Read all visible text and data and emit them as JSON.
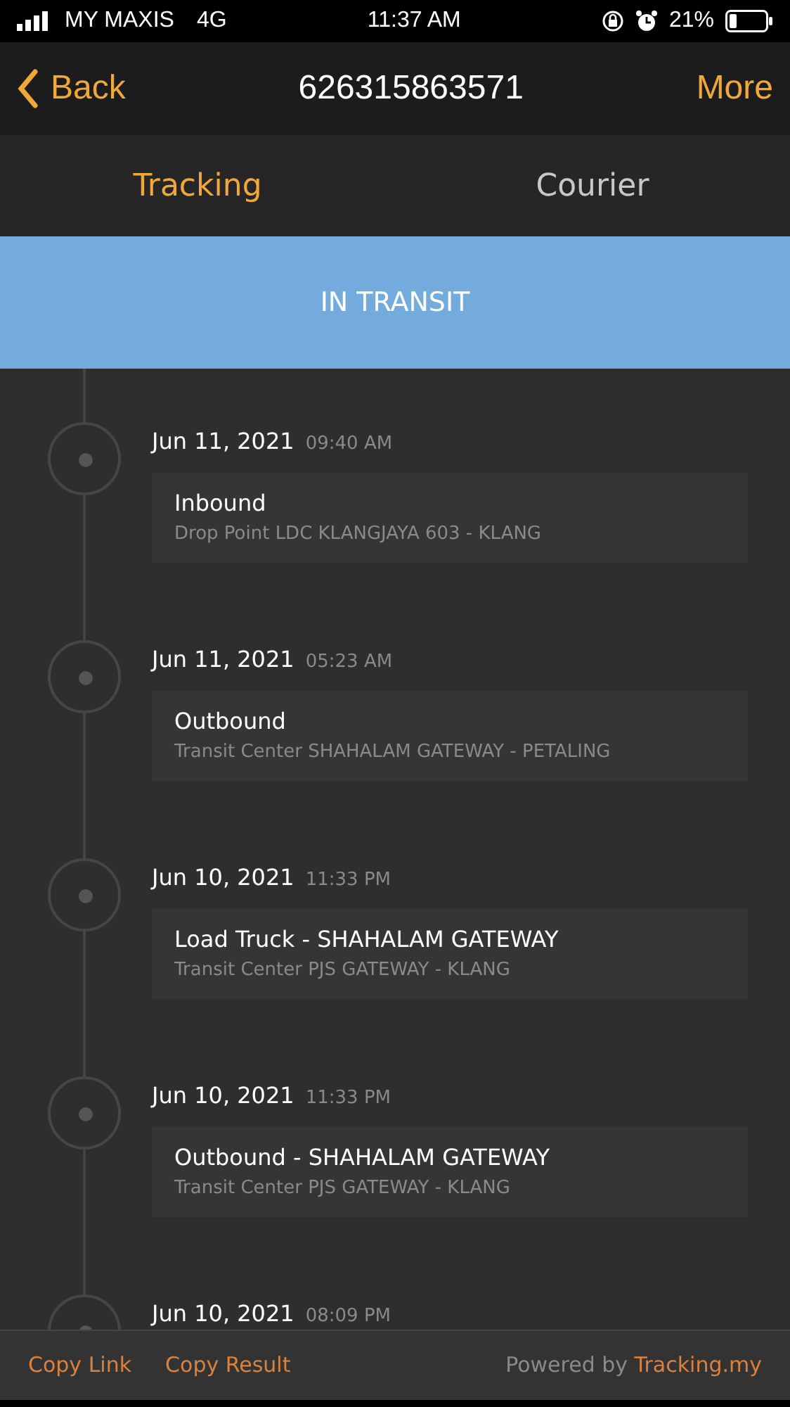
{
  "status_bar": {
    "carrier": "MY MAXIS",
    "network": "4G",
    "time": "11:37 AM",
    "battery": "21%"
  },
  "nav": {
    "back": "Back",
    "title": "626315863571",
    "more": "More"
  },
  "tabs": [
    {
      "label": "Tracking",
      "selected": true
    },
    {
      "label": "Courier",
      "selected": false
    }
  ],
  "status": "IN TRANSIT",
  "events": [
    {
      "date": "Jun 11, 2021",
      "time": "09:40 AM",
      "title": "Inbound",
      "location": "Drop Point LDC KLANGJAYA 603 - KLANG"
    },
    {
      "date": "Jun 11, 2021",
      "time": "05:23 AM",
      "title": "Outbound",
      "location": "Transit Center SHAHALAM GATEWAY - PETALING"
    },
    {
      "date": "Jun 10, 2021",
      "time": "11:33 PM",
      "title": "Load Truck - SHAHALAM GATEWAY",
      "location": "Transit Center PJS GATEWAY - KLANG"
    },
    {
      "date": "Jun 10, 2021",
      "time": "11:33 PM",
      "title": "Outbound - SHAHALAM GATEWAY",
      "location": "Transit Center PJS GATEWAY - KLANG"
    },
    {
      "date": "Jun 10, 2021",
      "time": "08:09 PM"
    }
  ],
  "footer": {
    "actions": [
      "Copy Link",
      "Copy Result"
    ],
    "powered_by": "Powered by",
    "link": "Tracking.my"
  }
}
